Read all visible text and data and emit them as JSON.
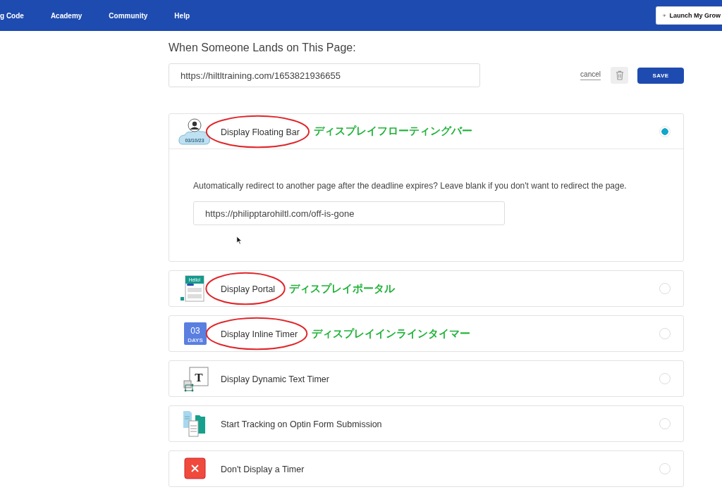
{
  "nav": {
    "items": [
      {
        "label": "g Code"
      },
      {
        "label": "Academy"
      },
      {
        "label": "Community"
      },
      {
        "label": "Help"
      }
    ],
    "launch_button": "Launch My Grow"
  },
  "heading": "When Someone Lands on This Page:",
  "page_url": {
    "value": "https://hiltltraining.com/1653821936655"
  },
  "actions": {
    "cancel": "cancel",
    "save": "SAVE"
  },
  "options": [
    {
      "kind": "floating-bar",
      "label": "Display Floating Bar",
      "selected": true,
      "expanded": true,
      "icon_text": "03/10/23",
      "circled": true,
      "annotation": "ディスプレイフローティングバー",
      "description": "Automatically redirect to another page after the deadline expires? Leave blank if you don't want to redirect the page.",
      "redirect_url": {
        "value": "https://philipptarohiltl.com/off-is-gone"
      }
    },
    {
      "kind": "portal",
      "label": "Display Portal",
      "selected": false,
      "expanded": false,
      "icon_text": "Hello!",
      "circled": true,
      "annotation": "ディスプレイポータル"
    },
    {
      "kind": "inline-timer",
      "label": "Display Inline Timer",
      "selected": false,
      "expanded": false,
      "icon_text": "03",
      "icon_subtext": "DAYS",
      "circled": true,
      "annotation": "ディスプレイインラインタイマー"
    },
    {
      "kind": "text-timer",
      "label": "Display Dynamic Text Timer",
      "selected": false,
      "expanded": false,
      "icon_text": "T",
      "circled": false
    },
    {
      "kind": "optin",
      "label": "Start Tracking on Optin Form Submission",
      "selected": false,
      "expanded": false,
      "circled": false
    },
    {
      "kind": "none",
      "label": "Don't Display a Timer",
      "selected": false,
      "expanded": false,
      "circled": false
    }
  ]
}
